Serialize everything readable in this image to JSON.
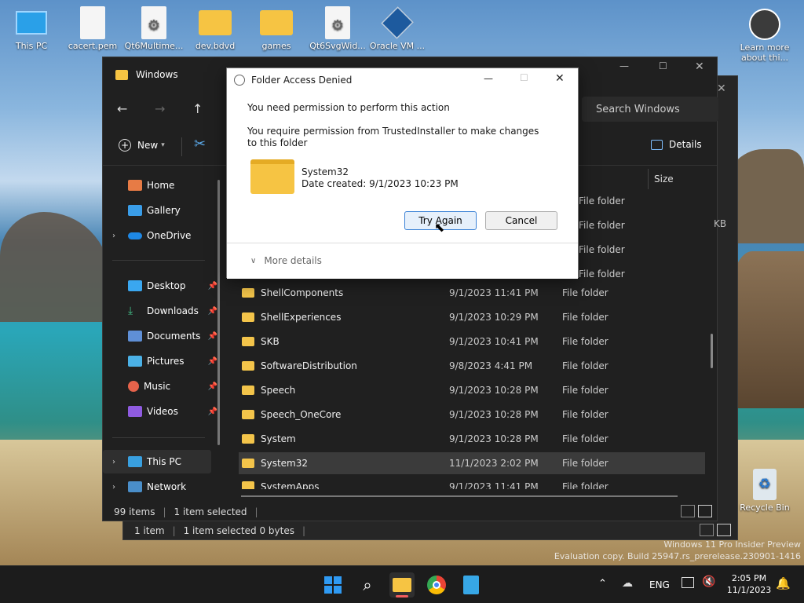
{
  "desktop": {
    "icons": [
      "This PC",
      "cacert.pem",
      "Qt6Multime...",
      "dev.bdvd",
      "games",
      "Qt6SvgWid...",
      "Oracle VM ..."
    ],
    "learn_more": "Learn more about thi...",
    "recycle": "Recycle Bin",
    "watermark1": "Windows 11 Pro Insider Preview",
    "watermark2": "Evaluation copy. Build 25947.rs_prerelease.230901-1416"
  },
  "explorer": {
    "title": "Windows",
    "search_placeholder": "Search Windows",
    "new_label": "New",
    "details_label": "Details",
    "size_header": "Size",
    "partial_size": "KB",
    "nav": {
      "home": "Home",
      "gallery": "Gallery",
      "onedrive": "OneDrive",
      "desktop": "Desktop",
      "downloads": "Downloads",
      "documents": "Documents",
      "pictures": "Pictures",
      "music": "Music",
      "videos": "Videos",
      "thispc": "This PC",
      "network": "Network"
    },
    "rows": [
      {
        "name": "ShellComponents",
        "date": "9/1/2023 11:41 PM",
        "type": "File folder"
      },
      {
        "name": "ShellExperiences",
        "date": "9/1/2023 10:29 PM",
        "type": "File folder"
      },
      {
        "name": "SKB",
        "date": "9/1/2023 10:41 PM",
        "type": "File folder"
      },
      {
        "name": "SoftwareDistribution",
        "date": "9/8/2023 4:41 PM",
        "type": "File folder"
      },
      {
        "name": "Speech",
        "date": "9/1/2023 10:28 PM",
        "type": "File folder"
      },
      {
        "name": "Speech_OneCore",
        "date": "9/1/2023 10:28 PM",
        "type": "File folder"
      },
      {
        "name": "System",
        "date": "9/1/2023 10:28 PM",
        "type": "File folder"
      },
      {
        "name": "System32",
        "date": "11/1/2023 2:02 PM",
        "type": "File folder"
      },
      {
        "name": "SystemApps",
        "date": "9/1/2023 11:41 PM",
        "type": "File folder"
      }
    ],
    "hidden_types": [
      "File folder",
      "File folder",
      "File folder",
      "File folder"
    ],
    "status_items": "99 items",
    "status_selected": "1 item selected"
  },
  "back_window": {
    "status_items": "1 item",
    "status_selected": "1 item selected  0 bytes"
  },
  "dialog": {
    "title": "Folder Access Denied",
    "line1": "You need permission to perform this action",
    "line2": "You require permission from TrustedInstaller to make changes to this folder",
    "folder_name": "System32",
    "date_created": "Date created: 9/1/2023 10:23 PM",
    "try_again": "Try Again",
    "cancel": "Cancel",
    "more_details": "More details"
  },
  "taskbar": {
    "lang": "ENG",
    "time": "2:05 PM",
    "date": "11/1/2023"
  }
}
